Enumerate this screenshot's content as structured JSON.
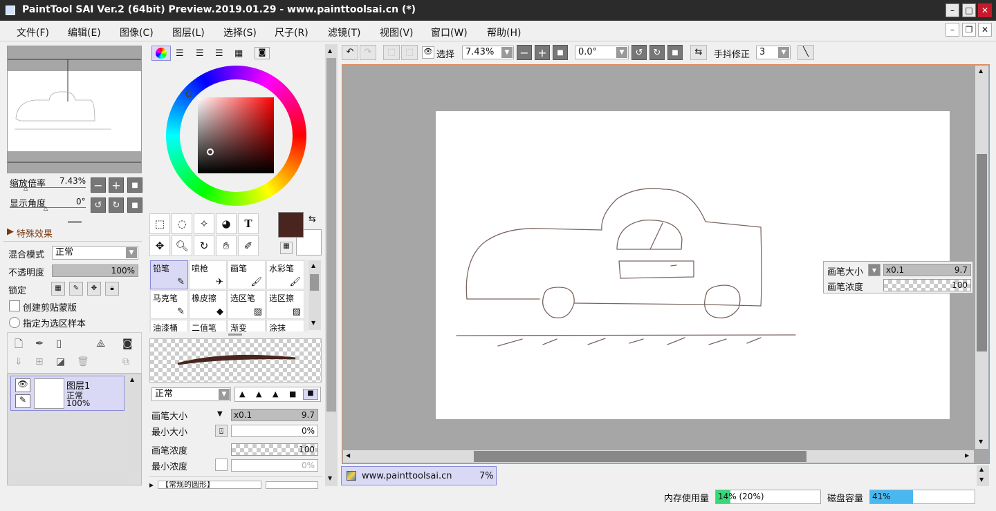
{
  "window": {
    "title": "PaintTool SAI Ver.2 (64bit) Preview.2019.01.29 - www.painttoolsai.cn (*)",
    "min_label": "–",
    "max_label": "□",
    "close_label": "✕"
  },
  "menu": [
    "文件(F)",
    "编辑(E)",
    "图像(C)",
    "图层(L)",
    "选择(S)",
    "尺子(R)",
    "滤镜(T)",
    "视图(V)",
    "窗口(W)",
    "帮助(H)"
  ],
  "navigator": {
    "zoom_label": "缩放倍率",
    "zoom_value": "7.43%",
    "angle_label": "显示角度",
    "angle_value": "0°"
  },
  "effects": {
    "header": "特殊效果",
    "blend_label": "混合模式",
    "blend_value": "正常",
    "opacity_label": "不透明度",
    "opacity_value": "100%",
    "opacity_level": 1.0,
    "lock_label": "锁定",
    "clip_label": "创建剪贴蒙版",
    "selection_source_label": "指定为选区样本"
  },
  "layers": [
    {
      "name": "图层1",
      "mode": "正常",
      "opacity": "100%"
    }
  ],
  "tools": {
    "brushes": [
      {
        "name": "铅笔",
        "selected": true
      },
      {
        "name": "喷枪",
        "selected": false
      },
      {
        "name": "画笔",
        "selected": false
      },
      {
        "name": "水彩笔",
        "selected": false
      },
      {
        "name": "马克笔",
        "selected": false
      },
      {
        "name": "橡皮擦",
        "selected": false
      },
      {
        "name": "选区笔",
        "selected": false
      },
      {
        "name": "选区擦",
        "selected": false
      },
      {
        "name": "油漆桶",
        "selected": false
      },
      {
        "name": "二值笔",
        "selected": false
      },
      {
        "name": "渐变",
        "selected": false
      },
      {
        "name": "涂抹",
        "selected": false
      }
    ],
    "blend_value": "正常",
    "brush_size_label": "画笔大小",
    "brush_size_mult": "x0.1",
    "brush_size_value": "9.7",
    "min_size_label": "最小大小",
    "min_size_value": "0%",
    "density_label": "画笔浓度",
    "density_value": "100",
    "min_density_label": "最小浓度",
    "min_density_value": "0%",
    "preset_label": "【常规的圆形】",
    "foreground_color": "#4a2520",
    "background_color": "#ffffff",
    "text_tool_label": "T"
  },
  "toolbar": {
    "select_label": "选择",
    "zoom_value": "7.43%",
    "angle_value": "0.0°",
    "stabilizer_label": "手抖修正",
    "stabilizer_value": "3"
  },
  "overlay": {
    "brush_size_label": "画笔大小",
    "brush_size_mult": "x0.1",
    "brush_size_value": "9.7",
    "density_label": "画笔浓度",
    "density_value": "100"
  },
  "document_tab": {
    "name": "www.painttoolsai.cn",
    "zoom": "7%"
  },
  "status": {
    "memory_label": "内存使用量",
    "memory_value": "14% (20%)",
    "memory_level": 0.14,
    "disk_label": "磁盘容量",
    "disk_value": "41%",
    "disk_level": 0.41
  },
  "colors": {
    "selection_accent": "#d9d9f5",
    "canvas_bg": "#a6a6a6",
    "stroke": "#7a6560",
    "memory_fill": "#3ad67a",
    "disk_fill": "#4ab8f0"
  }
}
